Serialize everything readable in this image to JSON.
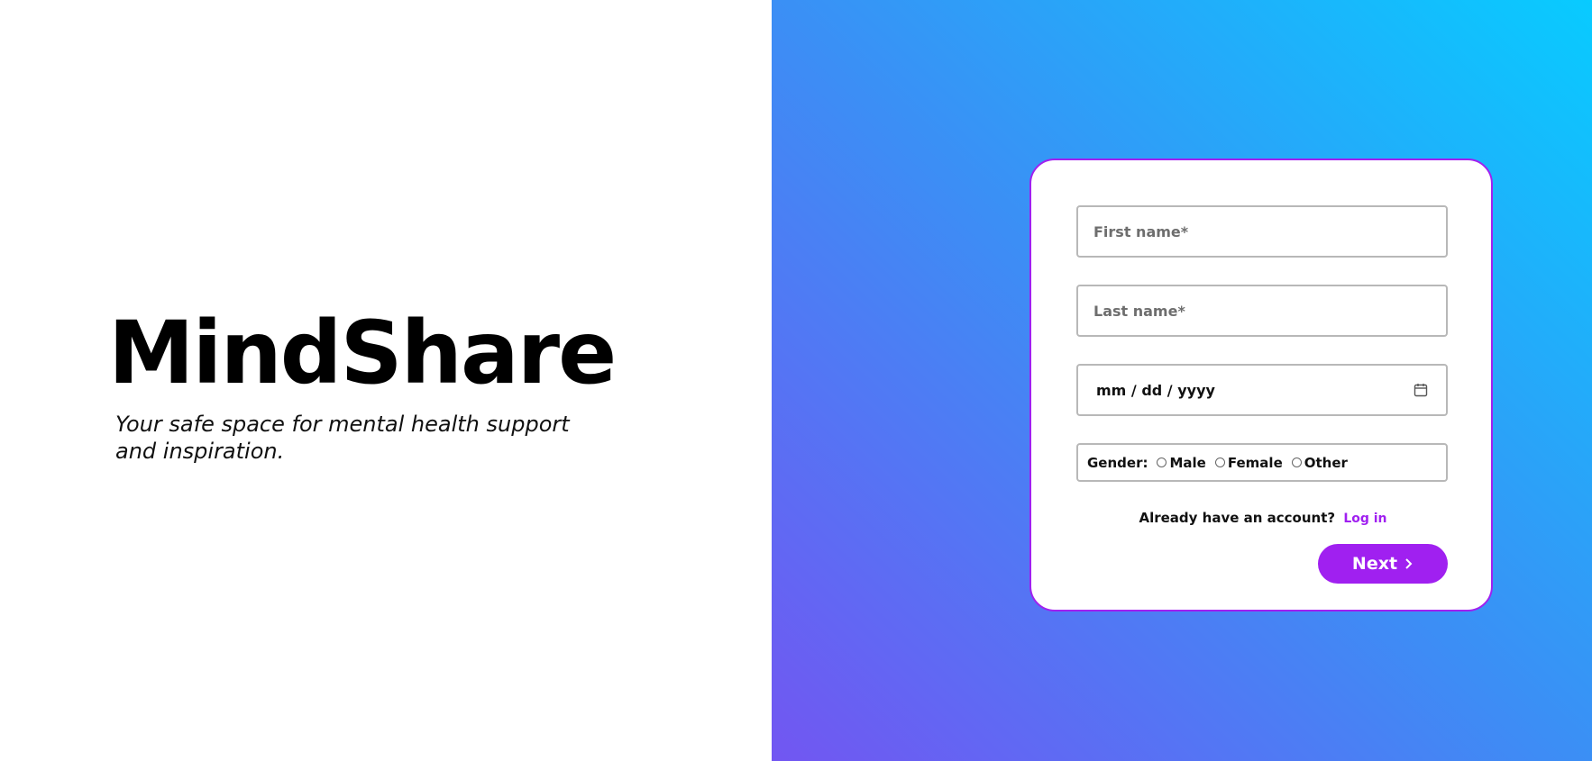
{
  "brand": {
    "title": "MindShare",
    "tagline": "Your safe space for mental health support and inspiration."
  },
  "form": {
    "first_name": {
      "placeholder": "First name*",
      "value": ""
    },
    "last_name": {
      "placeholder": "Last name*",
      "value": ""
    },
    "birth_date": {
      "placeholder": "mm / dd / yyyy",
      "icon": "calendar-icon"
    },
    "gender": {
      "label": "Gender:",
      "options": [
        "Male",
        "Female",
        "Other"
      ],
      "selected": null
    },
    "login_prompt": "Already have an account?",
    "login_link": "Log in",
    "next_button": "Next",
    "next_icon": "chevron-right-icon"
  },
  "colors": {
    "accent": "#a020f0",
    "gradient_start": "#7256f2",
    "gradient_mid": "#3b8ff5",
    "gradient_end": "#08cbff"
  }
}
